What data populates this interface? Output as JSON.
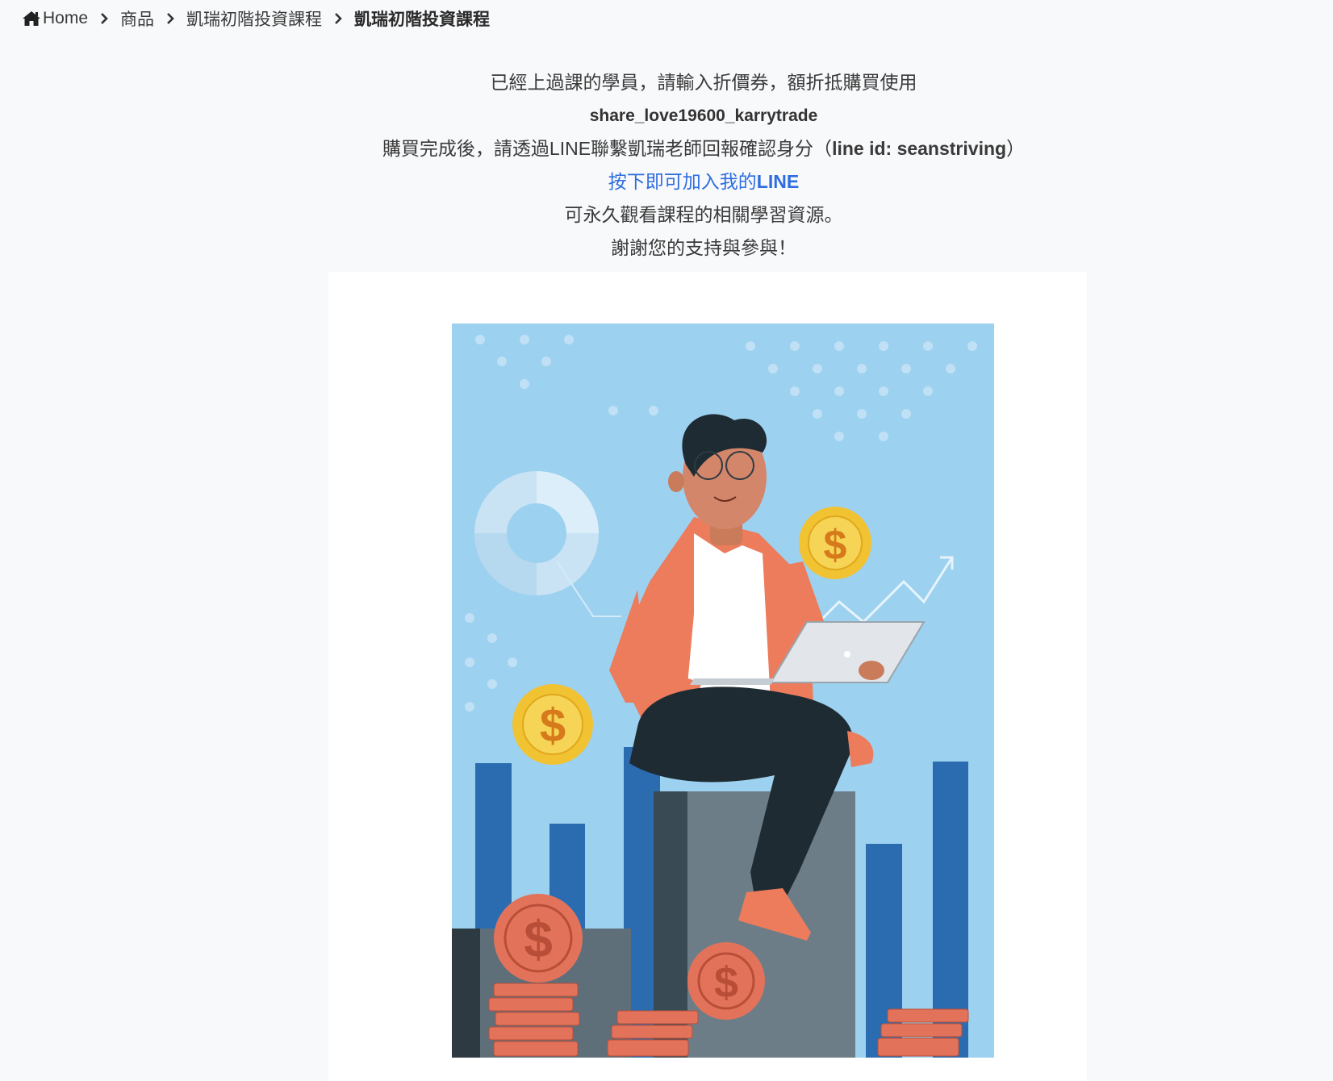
{
  "breadcrumb": {
    "items": [
      "Home",
      "商品",
      "凱瑞初階投資課程"
    ],
    "current": "凱瑞初階投資課程"
  },
  "message": {
    "line1": "已經上過課的學員，請輸入折價券，額折抵購買使用",
    "coupon_code": "share_love19600_karrytrade",
    "line3_prefix": "購買完成後，請透過LINE聯繫凱瑞老師回報確認身分（",
    "line3_lineid": "line id: seanstriving",
    "line3_suffix": "）",
    "link_prefix": "按下即可加入我的",
    "link_emphasis": "LINE",
    "line5": "可永久觀看課程的相關學習資源。",
    "line6": "謝謝您的支持與參與！"
  },
  "colors": {
    "link": "#2d6de0",
    "illustration_bg": "#9dd1f0",
    "bar_blue": "#2b6cb0",
    "coin_gold": "#f1c232",
    "coin_red": "#e2735a"
  },
  "illustration": {
    "icon": "person-laptop-coins-illustration",
    "coin_symbol": "$"
  }
}
